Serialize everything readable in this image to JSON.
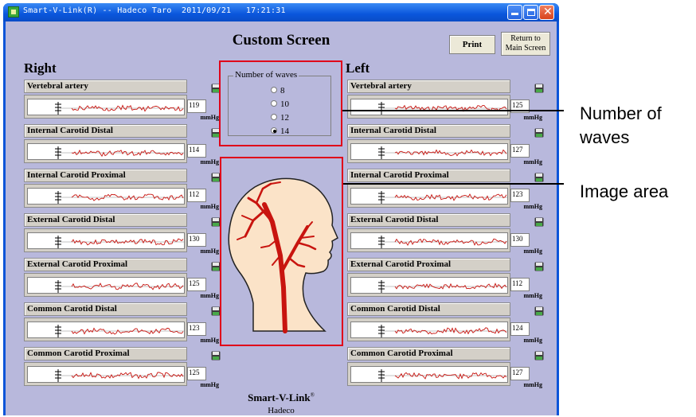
{
  "window": {
    "title": "Smart-V-Link(R) -- Hadeco Taro  2011/09/21   17:21:31"
  },
  "screen": {
    "title": "Custom Screen",
    "print_label": "Print",
    "return_label_line1": "Return to",
    "return_label_line2": "Main Screen"
  },
  "right": {
    "title": "Right",
    "panels": [
      {
        "label": "Vertebral artery",
        "value": "119",
        "unit": "mmHg"
      },
      {
        "label": "Internal Carotid Distal",
        "value": "114",
        "unit": "mmHg"
      },
      {
        "label": "Internal Carotid Proximal",
        "value": "112",
        "unit": "mmHg"
      },
      {
        "label": "External Carotid Distal",
        "value": "130",
        "unit": "mmHg"
      },
      {
        "label": "External Carotid Proximal",
        "value": "125",
        "unit": "mmHg"
      },
      {
        "label": "Common Carotid Distal",
        "value": "123",
        "unit": "mmHg"
      },
      {
        "label": "Common Carotid Proximal",
        "value": "125",
        "unit": "mmHg"
      }
    ]
  },
  "left": {
    "title": "Left",
    "panels": [
      {
        "label": "Vertebral artery",
        "value": "125",
        "unit": "mmHg"
      },
      {
        "label": "Internal Carotid Distal",
        "value": "127",
        "unit": "mmHg"
      },
      {
        "label": "Internal Carotid Proximal",
        "value": "123",
        "unit": "mmHg"
      },
      {
        "label": "External Carotid Distal",
        "value": "130",
        "unit": "mmHg"
      },
      {
        "label": "External Carotid Proximal",
        "value": "112",
        "unit": "mmHg"
      },
      {
        "label": "Common Carotid Distal",
        "value": "124",
        "unit": "mmHg"
      },
      {
        "label": "Common Carotid Proximal",
        "value": "127",
        "unit": "mmHg"
      }
    ]
  },
  "waves_group": {
    "legend": "Number of waves",
    "options": [
      "8",
      "10",
      "12",
      "14"
    ],
    "selected": "14"
  },
  "footer": {
    "brand": "Smart-V-Link",
    "brand_mark": "®",
    "company": "Hadeco"
  },
  "callouts": {
    "waves_line1": "Number of",
    "waves_line2": "waves",
    "image": "Image area"
  },
  "colors": {
    "background": "#b8b8dc",
    "titlebar": "#0a56dc",
    "highlight": "#e0001a",
    "artery": "#c8140f",
    "skin": "#fbe3c8"
  }
}
